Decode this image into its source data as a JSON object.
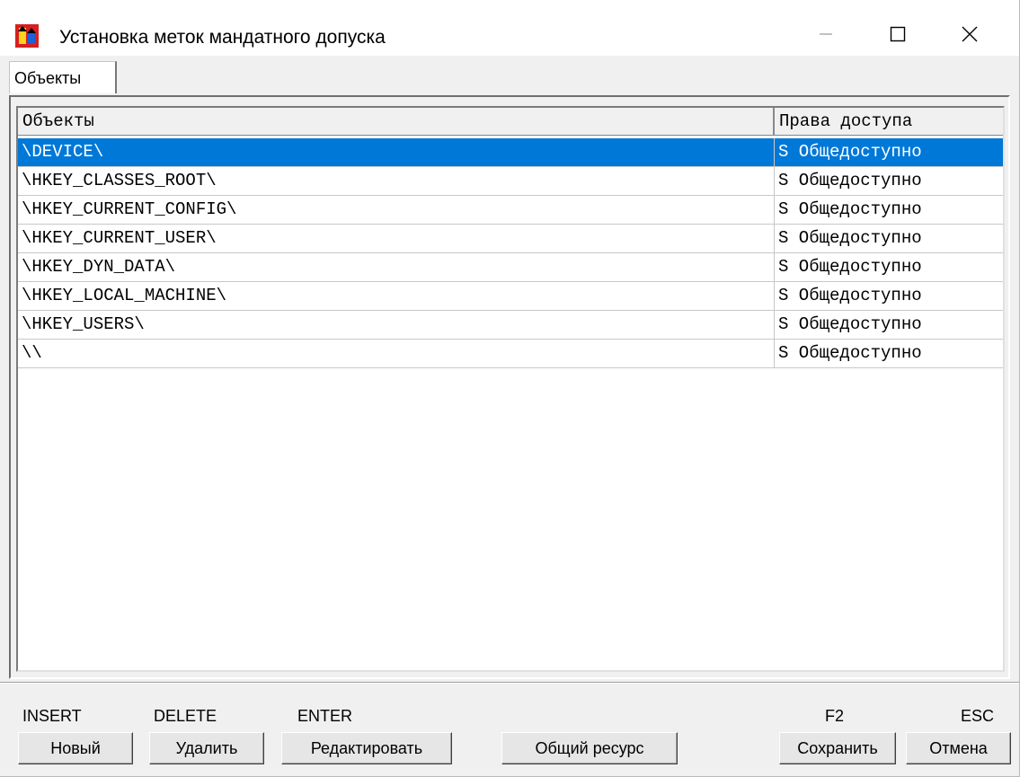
{
  "window": {
    "title": "Установка меток мандатного допуска",
    "controls": {
      "minimize_icon": "minimize-icon",
      "maximize_icon": "maximize-icon",
      "close_icon": "close-icon"
    },
    "accent_color": "#0078d7"
  },
  "tabs": [
    {
      "label": "Объекты",
      "active": true
    }
  ],
  "table": {
    "columns": [
      "Объекты",
      "Права доступа"
    ],
    "rows": [
      {
        "object": "\\DEVICE\\",
        "access": "S Общедоступно",
        "selected": true
      },
      {
        "object": "\\HKEY_CLASSES_ROOT\\",
        "access": "S Общедоступно"
      },
      {
        "object": "\\HKEY_CURRENT_CONFIG\\",
        "access": "S Общедоступно"
      },
      {
        "object": "\\HKEY_CURRENT_USER\\",
        "access": "S Общедоступно"
      },
      {
        "object": "\\HKEY_DYN_DATA\\",
        "access": "S Общедоступно"
      },
      {
        "object": "\\HKEY_LOCAL_MACHINE\\",
        "access": "S Общедоступно"
      },
      {
        "object": "\\HKEY_USERS\\",
        "access": "S Общедоступно"
      },
      {
        "object": "\\\\",
        "access": "S Общедоступно"
      }
    ]
  },
  "hotkeys": {
    "insert": "INSERT",
    "delete": "DELETE",
    "enter": "ENTER",
    "f2": "F2",
    "esc": "ESC"
  },
  "buttons": {
    "new": "Новый",
    "delete": "Удалить",
    "edit": "Редактировать",
    "shared": "Общий ресурс",
    "save": "Сохранить",
    "cancel": "Отмена"
  }
}
